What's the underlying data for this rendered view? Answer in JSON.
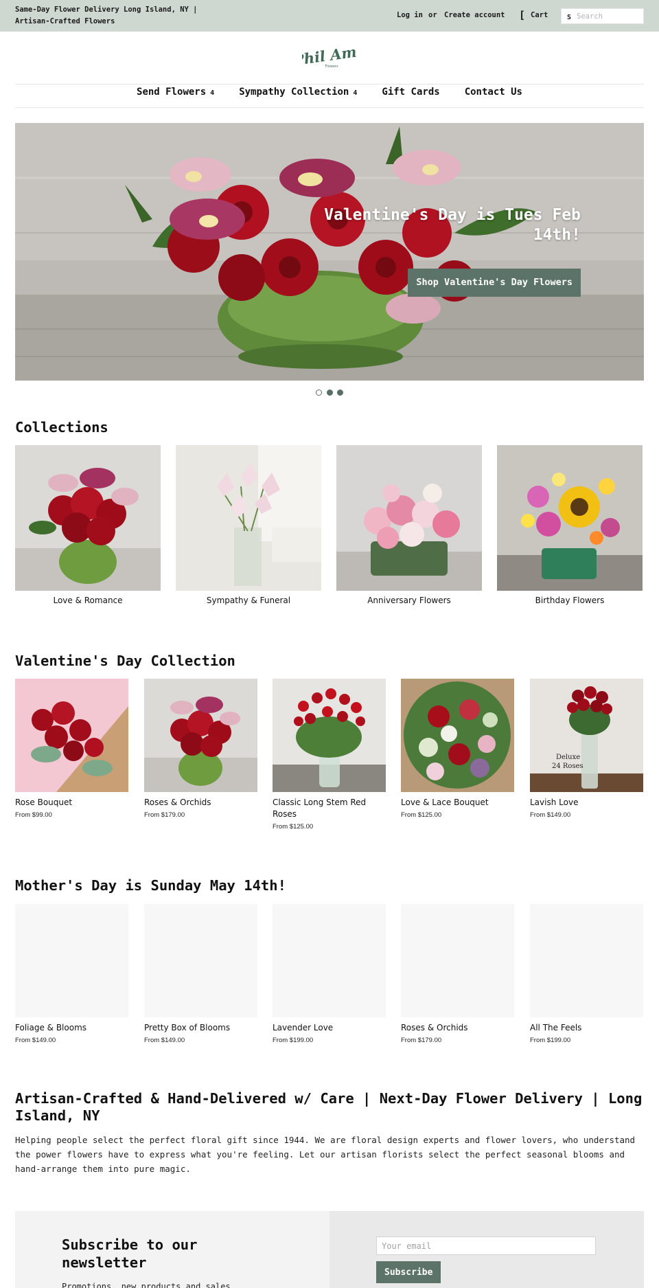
{
  "topbar": {
    "tagline": "Same-Day Flower Delivery Long Island, NY | Artisan-Crafted Flowers",
    "login": "Log in",
    "or": "or",
    "create_account": "Create account",
    "cart_icon": "cart-icon",
    "cart": "Cart",
    "search_icon": "search-icon",
    "search_glyph": "S",
    "search_placeholder": "Search"
  },
  "logo": {
    "text": "Phil Amy",
    "subtext": "Flowers",
    "color": "#3f6a55"
  },
  "nav": [
    {
      "label": "Send Flowers",
      "caret": "4"
    },
    {
      "label": "Sympathy Collection",
      "caret": "4"
    },
    {
      "label": "Gift Cards"
    },
    {
      "label": "Contact Us"
    }
  ],
  "hero": {
    "headline": "Valentine's Day is Tues Feb 14th!",
    "cta": "Shop Valentine's Day Flowers",
    "slides": 3,
    "active_slide": 1
  },
  "collections": {
    "title": "Collections",
    "items": [
      {
        "label": "Love & Romance"
      },
      {
        "label": "Sympathy & Funeral"
      },
      {
        "label": "Anniversary Flowers"
      },
      {
        "label": "Birthday Flowers"
      }
    ]
  },
  "valentines": {
    "title": "Valentine's Day Collection",
    "items": [
      {
        "name": "Rose Bouquet",
        "price": "From $99.00"
      },
      {
        "name": "Roses & Orchids",
        "price": "From $179.00"
      },
      {
        "name": "Classic Long Stem Red Roses",
        "price": "From $125.00"
      },
      {
        "name": "Love & Lace Bouquet",
        "price": "From $125.00"
      },
      {
        "name": "Lavish Love",
        "price": "From $149.00",
        "image_text": "Deluxe 24 Roses"
      }
    ]
  },
  "mothers_day": {
    "title": "Mother's Day is Sunday May 14th!",
    "items": [
      {
        "name": "Foliage & Blooms",
        "price": "From $149.00"
      },
      {
        "name": "Pretty Box of Blooms",
        "price": "From $149.00"
      },
      {
        "name": "Lavender Love",
        "price": "From $199.00"
      },
      {
        "name": "Roses & Orchids",
        "price": "From $179.00"
      },
      {
        "name": "All The Feels",
        "price": "From $199.00"
      }
    ]
  },
  "about": {
    "title": "Artisan-Crafted & Hand-Delivered w/ Care | Next-Day Flower Delivery | Long Island, NY",
    "body": "Helping people select the perfect floral gift since 1944. We are floral design experts and flower lovers, who understand the power flowers have to express what you're feeling. Let our artisan florists select the perfect seasonal blooms and hand-arrange them into pure magic."
  },
  "newsletter": {
    "title": "Subscribe to our newsletter",
    "subtitle": "Promotions, new products and sales",
    "placeholder": "Your email",
    "button": "Subscribe"
  },
  "colors": {
    "topbar_bg": "#cfd8d0",
    "accent": "#5b7369",
    "logo_green": "#3f6a55"
  }
}
